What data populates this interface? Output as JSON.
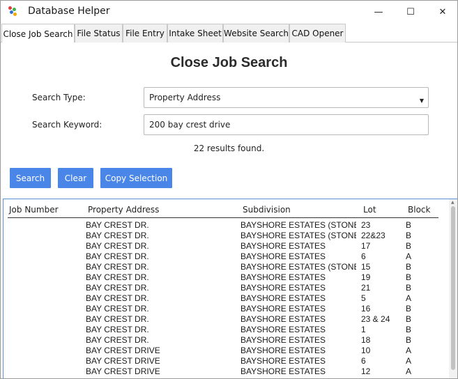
{
  "window": {
    "title": "Database Helper"
  },
  "window_controls": {
    "minimize": "—",
    "maximize": "☐",
    "close": "✕"
  },
  "tabs": [
    {
      "label": "Close Job Search",
      "active": true
    },
    {
      "label": "File Status",
      "active": false
    },
    {
      "label": "File Entry",
      "active": false
    },
    {
      "label": "Intake Sheet",
      "active": false
    },
    {
      "label": "Website Search",
      "active": false
    },
    {
      "label": "CAD Opener",
      "active": false
    }
  ],
  "page": {
    "title": "Close Job Search"
  },
  "form": {
    "search_type_label": "Search Type:",
    "search_type_value": "Property Address",
    "search_keyword_label": "Search Keyword:",
    "search_keyword_value": "200 bay crest drive"
  },
  "results_text": "22 results found.",
  "buttons": {
    "search": "Search",
    "clear": "Clear",
    "copy": "Copy Selection"
  },
  "colors": {
    "accent": "#4a86e8",
    "list_border": "#5a8fd6"
  },
  "table": {
    "columns": [
      "Job Number",
      "Property Address",
      "Subdivision",
      "Lot",
      "Block"
    ],
    "rows": [
      {
        "job": "",
        "address": "BAY CREST DR.",
        "subdivision": "BAYSHORE ESTATES (STONE GR",
        "lot": "23",
        "block": "B"
      },
      {
        "job": "",
        "address": "BAY CREST DR.",
        "subdivision": "BAYSHORE ESTATES (STONE GR",
        "lot": "22&23",
        "block": "B"
      },
      {
        "job": "",
        "address": "BAY CREST DR.",
        "subdivision": "BAYSHORE ESTATES",
        "lot": "17",
        "block": "B"
      },
      {
        "job": "",
        "address": "BAY CREST DR.",
        "subdivision": "BAYSHORE ESTATES",
        "lot": "6",
        "block": "A"
      },
      {
        "job": "",
        "address": "BAY CREST DR.",
        "subdivision": "BAYSHORE ESTATES (STONE GR",
        "lot": "15",
        "block": "B"
      },
      {
        "job": "",
        "address": "BAY CREST DR.",
        "subdivision": "BAYSHORE ESTATES",
        "lot": "19",
        "block": "B"
      },
      {
        "job": "",
        "address": "BAY CREST DR.",
        "subdivision": "BAYSHORE ESTATES",
        "lot": "21",
        "block": "B"
      },
      {
        "job": "",
        "address": "BAY CREST DR.",
        "subdivision": "BAYSHORE ESTATES",
        "lot": "5",
        "block": "A"
      },
      {
        "job": "",
        "address": "BAY CREST DR.",
        "subdivision": "BAYSHORE ESTATES",
        "lot": "16",
        "block": "B"
      },
      {
        "job": "",
        "address": "BAY CREST DR.",
        "subdivision": "BAYSHORE ESTATES",
        "lot": "23 & 24",
        "block": "B"
      },
      {
        "job": "",
        "address": "BAY CREST DR.",
        "subdivision": "BAYSHORE ESTATES",
        "lot": "1",
        "block": "B"
      },
      {
        "job": "",
        "address": "BAY CREST DR.",
        "subdivision": "BAYSHORE ESTATES",
        "lot": "18",
        "block": "B"
      },
      {
        "job": "",
        "address": "BAY CREST DRIVE",
        "subdivision": "BAYSHORE ESTATES",
        "lot": "10",
        "block": "A"
      },
      {
        "job": "",
        "address": "BAY CREST DRIVE",
        "subdivision": "BAYSHORE ESTATES",
        "lot": "6",
        "block": "A"
      },
      {
        "job": "",
        "address": "BAY CREST DRIVE",
        "subdivision": "BAYSHORE ESTATES",
        "lot": "12",
        "block": "A"
      }
    ]
  }
}
